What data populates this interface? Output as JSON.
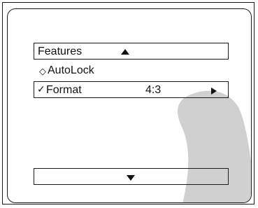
{
  "menu": {
    "header": {
      "label": "Features",
      "up_icon": "triangle-up-icon"
    },
    "items": [
      {
        "marker": "◇",
        "label": "AutoLock",
        "value": ""
      },
      {
        "marker": "✓",
        "label": "Format",
        "value": "4:3",
        "next_icon": "triangle-right-icon"
      }
    ],
    "footer": {
      "down_icon": "triangle-down-icon"
    }
  },
  "colors": {
    "ink": "#111111",
    "glare": "#d0d0d0",
    "background": "#ffffff"
  }
}
